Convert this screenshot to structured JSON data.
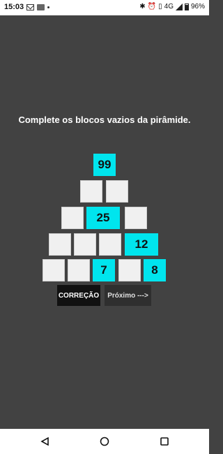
{
  "status_bar": {
    "time": "15:03",
    "network": "4G",
    "battery": "96%"
  },
  "instruction": "Complete os blocos vazios da pirâmide.",
  "pyramid": {
    "rows": [
      [
        "99"
      ],
      [
        "",
        ""
      ],
      [
        "",
        "25",
        ""
      ],
      [
        "",
        "",
        "",
        "12"
      ],
      [
        "",
        "",
        "7",
        "",
        "8"
      ]
    ]
  },
  "buttons": {
    "correcao": "CORREÇÃO",
    "proximo": "Próximo --->"
  },
  "colors": {
    "background": "#424242",
    "filled_block": "#00e5ee",
    "empty_block": "#f0f0f0"
  }
}
